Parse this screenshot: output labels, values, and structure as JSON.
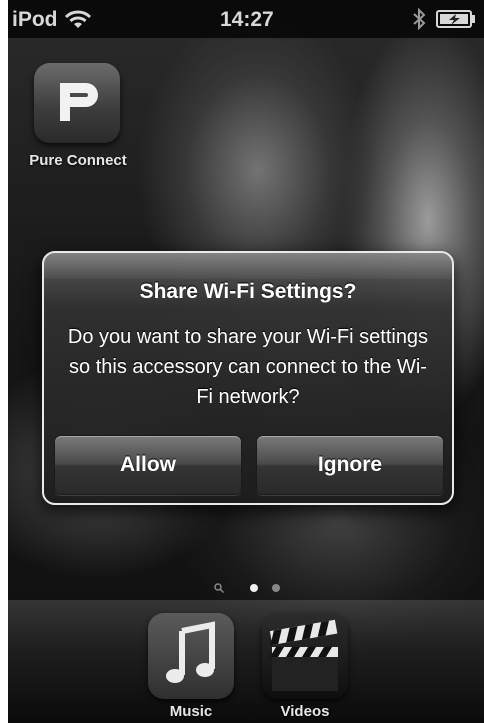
{
  "status_bar": {
    "carrier": "iPod",
    "time": "14:27"
  },
  "home_screen": {
    "apps": [
      {
        "label": "Pure Connect",
        "icon": "pure-connect-icon"
      }
    ],
    "dock": [
      {
        "label": "Music",
        "icon": "music-note-icon"
      },
      {
        "label": "Videos",
        "icon": "clapperboard-icon"
      }
    ],
    "page_indicator": {
      "pages": 2,
      "current": 1
    }
  },
  "alert": {
    "title": "Share Wi-Fi Settings?",
    "message": "Do you want to share your Wi-Fi settings so this accessory can connect to the Wi-Fi network?",
    "buttons": {
      "allow": "Allow",
      "ignore": "Ignore"
    }
  }
}
